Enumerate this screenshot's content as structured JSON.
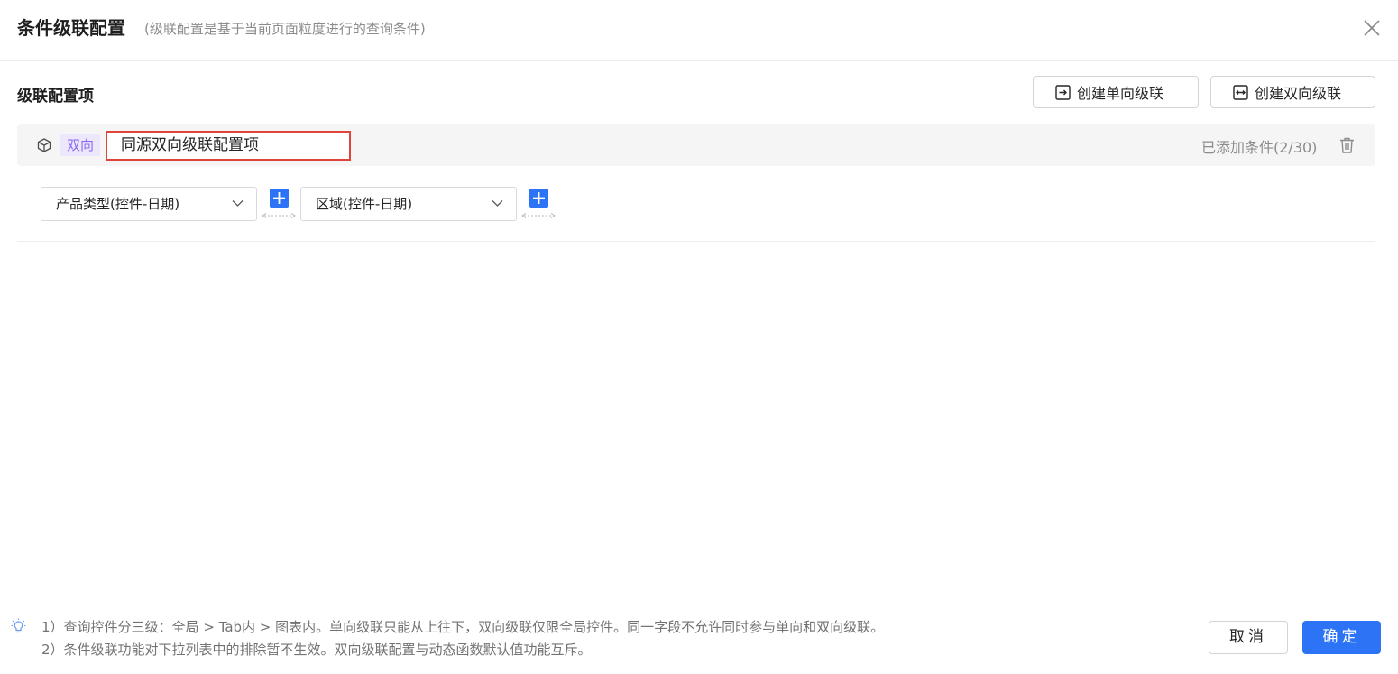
{
  "dialog": {
    "title": "条件级联配置",
    "subtitle": "(级联配置是基于当前页面粒度进行的查询条件)"
  },
  "section": {
    "title": "级联配置项",
    "create_single_label": "创建单向级联",
    "create_double_label": "创建双向级联"
  },
  "cascade_item": {
    "tag": "双向",
    "name": "同源双向级联配置项",
    "added_text": "已添加条件(2/30)",
    "conditions": [
      {
        "label": "产品类型(控件-日期)"
      },
      {
        "label": "区域(控件-日期)"
      }
    ]
  },
  "footer": {
    "note1": "1）查询控件分三级：全局 > Tab内 > 图表内。单向级联只能从上往下，双向级联仅限全局控件。同一字段不允许同时参与单向和双向级联。",
    "note2": "2）条件级联功能对下拉列表中的排除暂不生效。双向级联配置与动态函数默认值功能互斥。",
    "cancel_label": "取消",
    "ok_label": "确定"
  },
  "colors": {
    "primary": "#2c74f5",
    "tag_bg": "#ece7fb",
    "tag_text": "#8b6cf0",
    "highlight_border": "#e0453c"
  },
  "icons": [
    "close-icon",
    "arrow-right-box-icon",
    "arrow-both-box-icon",
    "cube-icon",
    "trash-icon",
    "chevron-down-icon",
    "plus-icon",
    "bidirectional-link-icon",
    "lightbulb-icon"
  ]
}
